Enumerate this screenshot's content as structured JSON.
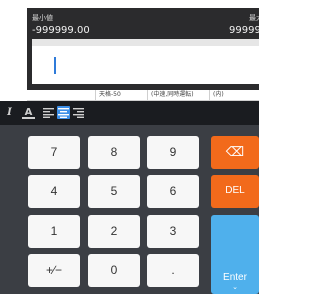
{
  "range": {
    "min_label": "最小値",
    "min_value": "-999999.00",
    "max_label": "最大",
    "max_value": "999999."
  },
  "input": {
    "value": ""
  },
  "table": {
    "cells": [
      "天格-50",
      "(中速,同時運転)",
      "(内)"
    ]
  },
  "toolbar": {
    "italic_glyph": "I",
    "text_color_glyph": "A"
  },
  "keys": {
    "k7": "7",
    "k8": "8",
    "k9": "9",
    "k4": "4",
    "k5": "5",
    "k6": "6",
    "k1": "1",
    "k2": "2",
    "k3": "3",
    "sign": "+∕−",
    "k0": "0",
    "dot": ".",
    "backspace": "⌫",
    "del": "DEL",
    "enter": "Enter",
    "enter_sub": "⌄"
  },
  "colors": {
    "accent_orange": "#f26a1b",
    "accent_blue": "#4fb0ec",
    "cursor": "#2f7bd9",
    "keyboard_bg": "#3b3e44"
  }
}
